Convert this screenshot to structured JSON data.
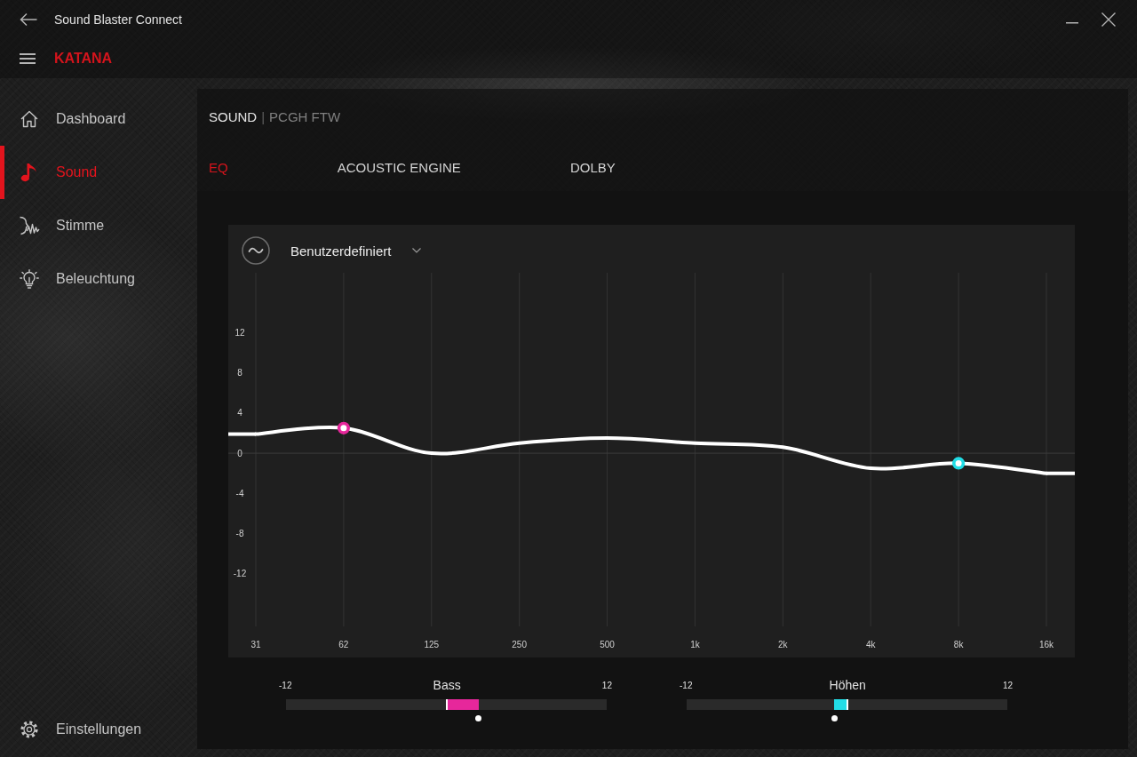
{
  "window": {
    "title": "Sound Blaster Connect"
  },
  "device": {
    "name": "KATANA"
  },
  "sidebar": {
    "items": [
      {
        "label": "Dashboard",
        "selected": false
      },
      {
        "label": "Sound",
        "selected": true
      },
      {
        "label": "Stimme",
        "selected": false
      },
      {
        "label": "Beleuchtung",
        "selected": false
      }
    ],
    "footer_item": {
      "label": "Einstellungen"
    }
  },
  "breadcrumb": {
    "section": "SOUND",
    "separator": "|",
    "profile": "PCGH FTW"
  },
  "tabs": [
    {
      "label": "EQ",
      "selected": true
    },
    {
      "label": "ACOUSTIC ENGINE",
      "selected": false
    },
    {
      "label": "DOLBY",
      "selected": false
    }
  ],
  "eq": {
    "preset": {
      "value": "Benutzerdefiniert"
    },
    "chart_data": {
      "type": "line",
      "categories": [
        "31",
        "62",
        "125",
        "250",
        "500",
        "1k",
        "2k",
        "4k",
        "8k",
        "16k"
      ],
      "series": [
        {
          "color": "#ffffff",
          "values": [
            1.9,
            2.5,
            0,
            1,
            1.5,
            1,
            0.6,
            -1.5,
            -1,
            -2
          ]
        }
      ],
      "ylim": [
        -20.3,
        22.7
      ],
      "yticks": [
        12,
        8,
        4,
        0,
        -4,
        -8,
        -12
      ],
      "grid": true,
      "annotations": [
        {
          "x": "62"
        },
        {
          "x": "8k"
        }
      ]
    },
    "sliders": [
      {
        "label": "Bass",
        "min_label": "-12",
        "max_label": "12",
        "level": 0.6,
        "color": "#e6279b"
      },
      {
        "label": "Höhen",
        "min_label": "-12",
        "max_label": "12",
        "level": 0.46,
        "color": "#22dde6"
      }
    ]
  }
}
